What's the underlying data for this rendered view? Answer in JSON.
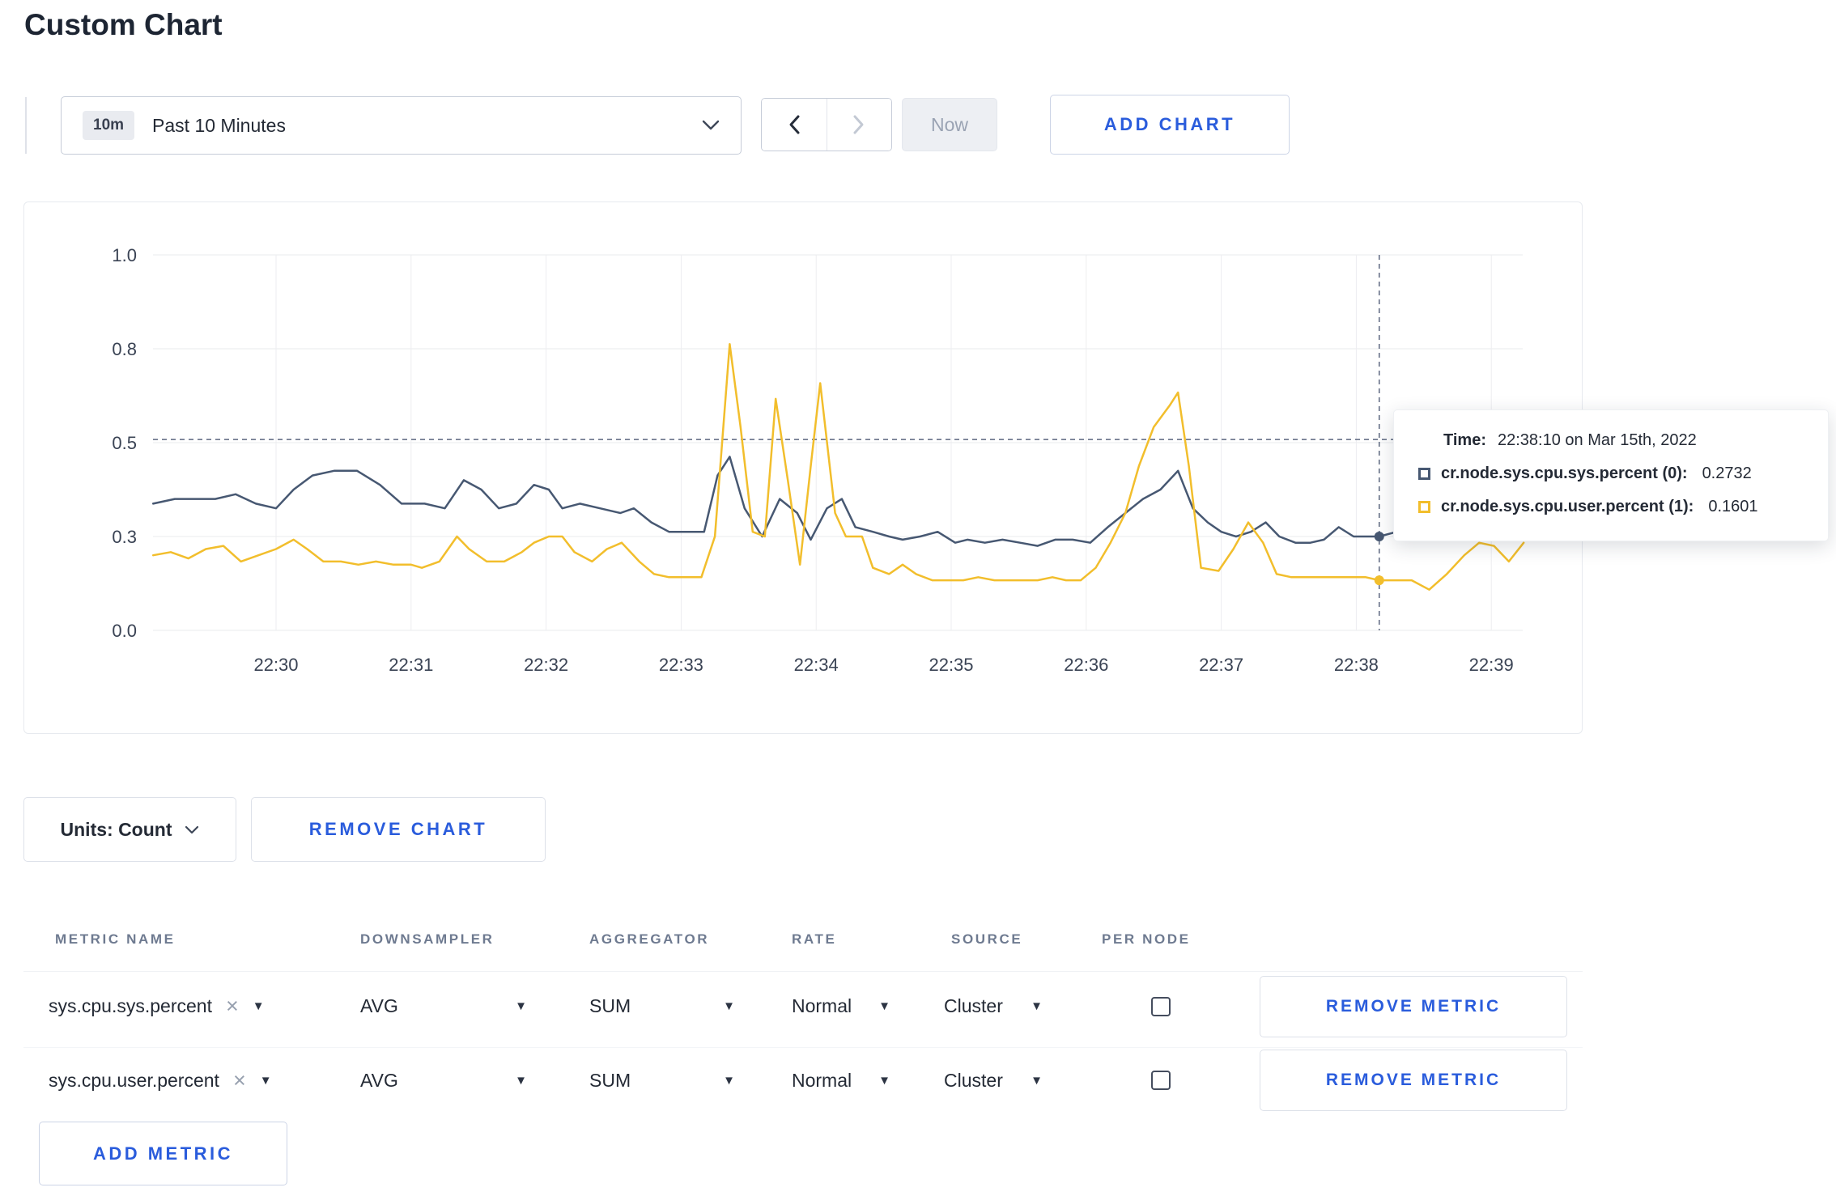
{
  "page": {
    "title": "Custom Chart"
  },
  "toolbar": {
    "range": {
      "badge": "10m",
      "label": "Past 10 Minutes"
    },
    "now_label": "Now",
    "add_chart_label": "ADD CHART"
  },
  "chart_data": {
    "type": "line",
    "title": "",
    "xlabel": "",
    "ylabel": "",
    "grid": true,
    "x_unit": "minutes after 22:30",
    "x_ticks": [
      "22:30",
      "22:31",
      "22:32",
      "22:33",
      "22:34",
      "22:35",
      "22:36",
      "22:37",
      "22:38",
      "22:39"
    ],
    "y_ticks": [
      0.0,
      0.3,
      0.5,
      0.8,
      1.0
    ],
    "y_tick_labels": [
      "0.0",
      "0.3",
      "0.5",
      "0.8",
      "1.0"
    ],
    "y_axis_note": "ticks rendered equally spaced",
    "x_range_minutes": [
      -0.91,
      9.24
    ],
    "crosshair": {
      "time_minutes": 8.17,
      "time_label": "22:38:10",
      "value_line": 0.51
    },
    "series": [
      {
        "name": "cr.node.sys.cpu.sys.percent",
        "color": "#475872",
        "points": [
          [
            -0.91,
            0.37
          ],
          [
            -0.75,
            0.38
          ],
          [
            -0.6,
            0.38
          ],
          [
            -0.45,
            0.38
          ],
          [
            -0.3,
            0.39
          ],
          [
            -0.15,
            0.37
          ],
          [
            0,
            0.36
          ],
          [
            0.13,
            0.4
          ],
          [
            0.27,
            0.43
          ],
          [
            0.43,
            0.44
          ],
          [
            0.6,
            0.44
          ],
          [
            0.77,
            0.41
          ],
          [
            0.93,
            0.37
          ],
          [
            1.1,
            0.37
          ],
          [
            1.25,
            0.36
          ],
          [
            1.39,
            0.42
          ],
          [
            1.52,
            0.4
          ],
          [
            1.65,
            0.36
          ],
          [
            1.78,
            0.37
          ],
          [
            1.91,
            0.41
          ],
          [
            2.02,
            0.4
          ],
          [
            2.12,
            0.36
          ],
          [
            2.25,
            0.37
          ],
          [
            2.4,
            0.36
          ],
          [
            2.55,
            0.35
          ],
          [
            2.65,
            0.36
          ],
          [
            2.78,
            0.33
          ],
          [
            2.91,
            0.31
          ],
          [
            3.04,
            0.31
          ],
          [
            3.17,
            0.31
          ],
          [
            3.27,
            0.43
          ],
          [
            3.36,
            0.47
          ],
          [
            3.47,
            0.36
          ],
          [
            3.6,
            0.3
          ],
          [
            3.73,
            0.38
          ],
          [
            3.86,
            0.35
          ],
          [
            3.96,
            0.29
          ],
          [
            4.08,
            0.36
          ],
          [
            4.19,
            0.38
          ],
          [
            4.29,
            0.32
          ],
          [
            4.42,
            0.31
          ],
          [
            4.54,
            0.3
          ],
          [
            4.64,
            0.29
          ],
          [
            4.77,
            0.3
          ],
          [
            4.9,
            0.31
          ],
          [
            5.03,
            0.28
          ],
          [
            5.12,
            0.29
          ],
          [
            5.25,
            0.28
          ],
          [
            5.38,
            0.29
          ],
          [
            5.51,
            0.28
          ],
          [
            5.64,
            0.27
          ],
          [
            5.77,
            0.29
          ],
          [
            5.9,
            0.29
          ],
          [
            6.03,
            0.28
          ],
          [
            6.16,
            0.32
          ],
          [
            6.29,
            0.35
          ],
          [
            6.42,
            0.38
          ],
          [
            6.55,
            0.4
          ],
          [
            6.68,
            0.44
          ],
          [
            6.79,
            0.36
          ],
          [
            6.9,
            0.33
          ],
          [
            7,
            0.31
          ],
          [
            7.11,
            0.3
          ],
          [
            7.22,
            0.31
          ],
          [
            7.33,
            0.33
          ],
          [
            7.43,
            0.3
          ],
          [
            7.55,
            0.28
          ],
          [
            7.66,
            0.28
          ],
          [
            7.76,
            0.29
          ],
          [
            7.87,
            0.32
          ],
          [
            7.98,
            0.3
          ],
          [
            8.11,
            0.3
          ],
          [
            8.17,
            0.3
          ],
          [
            8.3,
            0.31
          ],
          [
            8.45,
            0.3
          ],
          [
            8.6,
            0.3
          ],
          [
            8.75,
            0.29
          ],
          [
            8.9,
            0.3
          ],
          [
            9.05,
            0.3
          ],
          [
            9.2,
            0.31
          ]
        ]
      },
      {
        "name": "cr.node.sys.cpu.user.percent",
        "color": "#f2be2c",
        "points": [
          [
            -0.91,
            0.24
          ],
          [
            -0.78,
            0.25
          ],
          [
            -0.65,
            0.23
          ],
          [
            -0.52,
            0.26
          ],
          [
            -0.39,
            0.27
          ],
          [
            -0.26,
            0.22
          ],
          [
            -0.13,
            0.24
          ],
          [
            0,
            0.26
          ],
          [
            0.13,
            0.29
          ],
          [
            0.23,
            0.26
          ],
          [
            0.35,
            0.22
          ],
          [
            0.48,
            0.22
          ],
          [
            0.61,
            0.21
          ],
          [
            0.74,
            0.22
          ],
          [
            0.87,
            0.21
          ],
          [
            1,
            0.21
          ],
          [
            1.08,
            0.2
          ],
          [
            1.21,
            0.22
          ],
          [
            1.34,
            0.3
          ],
          [
            1.43,
            0.26
          ],
          [
            1.56,
            0.22
          ],
          [
            1.69,
            0.22
          ],
          [
            1.82,
            0.25
          ],
          [
            1.91,
            0.28
          ],
          [
            2.02,
            0.3
          ],
          [
            2.12,
            0.3
          ],
          [
            2.21,
            0.25
          ],
          [
            2.34,
            0.22
          ],
          [
            2.45,
            0.26
          ],
          [
            2.56,
            0.28
          ],
          [
            2.69,
            0.22
          ],
          [
            2.8,
            0.18
          ],
          [
            2.91,
            0.17
          ],
          [
            3.04,
            0.17
          ],
          [
            3.15,
            0.17
          ],
          [
            3.25,
            0.3
          ],
          [
            3.36,
            0.81
          ],
          [
            3.44,
            0.55
          ],
          [
            3.53,
            0.31
          ],
          [
            3.62,
            0.3
          ],
          [
            3.7,
            0.64
          ],
          [
            3.79,
            0.42
          ],
          [
            3.88,
            0.21
          ],
          [
            3.96,
            0.45
          ],
          [
            4.03,
            0.69
          ],
          [
            4.14,
            0.35
          ],
          [
            4.22,
            0.3
          ],
          [
            4.34,
            0.3
          ],
          [
            4.42,
            0.2
          ],
          [
            4.54,
            0.18
          ],
          [
            4.64,
            0.21
          ],
          [
            4.74,
            0.18
          ],
          [
            4.86,
            0.16
          ],
          [
            4.99,
            0.16
          ],
          [
            5.09,
            0.16
          ],
          [
            5.2,
            0.17
          ],
          [
            5.32,
            0.16
          ],
          [
            5.42,
            0.16
          ],
          [
            5.52,
            0.16
          ],
          [
            5.64,
            0.16
          ],
          [
            5.75,
            0.17
          ],
          [
            5.85,
            0.16
          ],
          [
            5.96,
            0.16
          ],
          [
            6.07,
            0.2
          ],
          [
            6.18,
            0.28
          ],
          [
            6.29,
            0.35
          ],
          [
            6.39,
            0.45
          ],
          [
            6.5,
            0.55
          ],
          [
            6.62,
            0.62
          ],
          [
            6.68,
            0.66
          ],
          [
            6.76,
            0.45
          ],
          [
            6.85,
            0.2
          ],
          [
            6.98,
            0.19
          ],
          [
            7.09,
            0.26
          ],
          [
            7.2,
            0.33
          ],
          [
            7.31,
            0.28
          ],
          [
            7.41,
            0.18
          ],
          [
            7.52,
            0.17
          ],
          [
            7.63,
            0.17
          ],
          [
            7.74,
            0.17
          ],
          [
            7.85,
            0.17
          ],
          [
            7.95,
            0.17
          ],
          [
            8.07,
            0.17
          ],
          [
            8.17,
            0.16
          ],
          [
            8.28,
            0.16
          ],
          [
            8.41,
            0.16
          ],
          [
            8.54,
            0.13
          ],
          [
            8.67,
            0.18
          ],
          [
            8.8,
            0.24
          ],
          [
            8.91,
            0.28
          ],
          [
            9.02,
            0.27
          ],
          [
            9.13,
            0.22
          ],
          [
            9.24,
            0.28
          ]
        ]
      }
    ]
  },
  "tooltip": {
    "time_label": "Time:",
    "time_value": "22:38:10 on Mar 15th, 2022",
    "rows": [
      {
        "label": "cr.node.sys.cpu.sys.percent (0):",
        "value": "0.2732",
        "color": "#475872"
      },
      {
        "label": "cr.node.sys.cpu.user.percent (1):",
        "value": "0.1601",
        "color": "#f2be2c"
      }
    ]
  },
  "chart_footer": {
    "units_label": "Units: Count",
    "remove_chart_label": "REMOVE CHART"
  },
  "metrics_table": {
    "headers": [
      "METRIC NAME",
      "DOWNSAMPLER",
      "AGGREGATOR",
      "RATE",
      "SOURCE",
      "PER NODE"
    ],
    "rows": [
      {
        "metric_name": "sys.cpu.sys.percent",
        "downsampler": "AVG",
        "aggregator": "SUM",
        "rate": "Normal",
        "source": "Cluster",
        "per_node_checked": false,
        "remove_label": "REMOVE METRIC"
      },
      {
        "metric_name": "sys.cpu.user.percent",
        "downsampler": "AVG",
        "aggregator": "SUM",
        "rate": "Normal",
        "source": "Cluster",
        "per_node_checked": false,
        "remove_label": "REMOVE METRIC"
      }
    ],
    "add_metric_label": "ADD METRIC"
  },
  "icons": {
    "clear": "×",
    "caret_down": "▼"
  },
  "colors": {
    "accent_blue": "#2a5cdc",
    "series_sys": "#475872",
    "series_user": "#f2be2c",
    "grid": "#e9ebee",
    "crosshair": "#5d6880"
  }
}
